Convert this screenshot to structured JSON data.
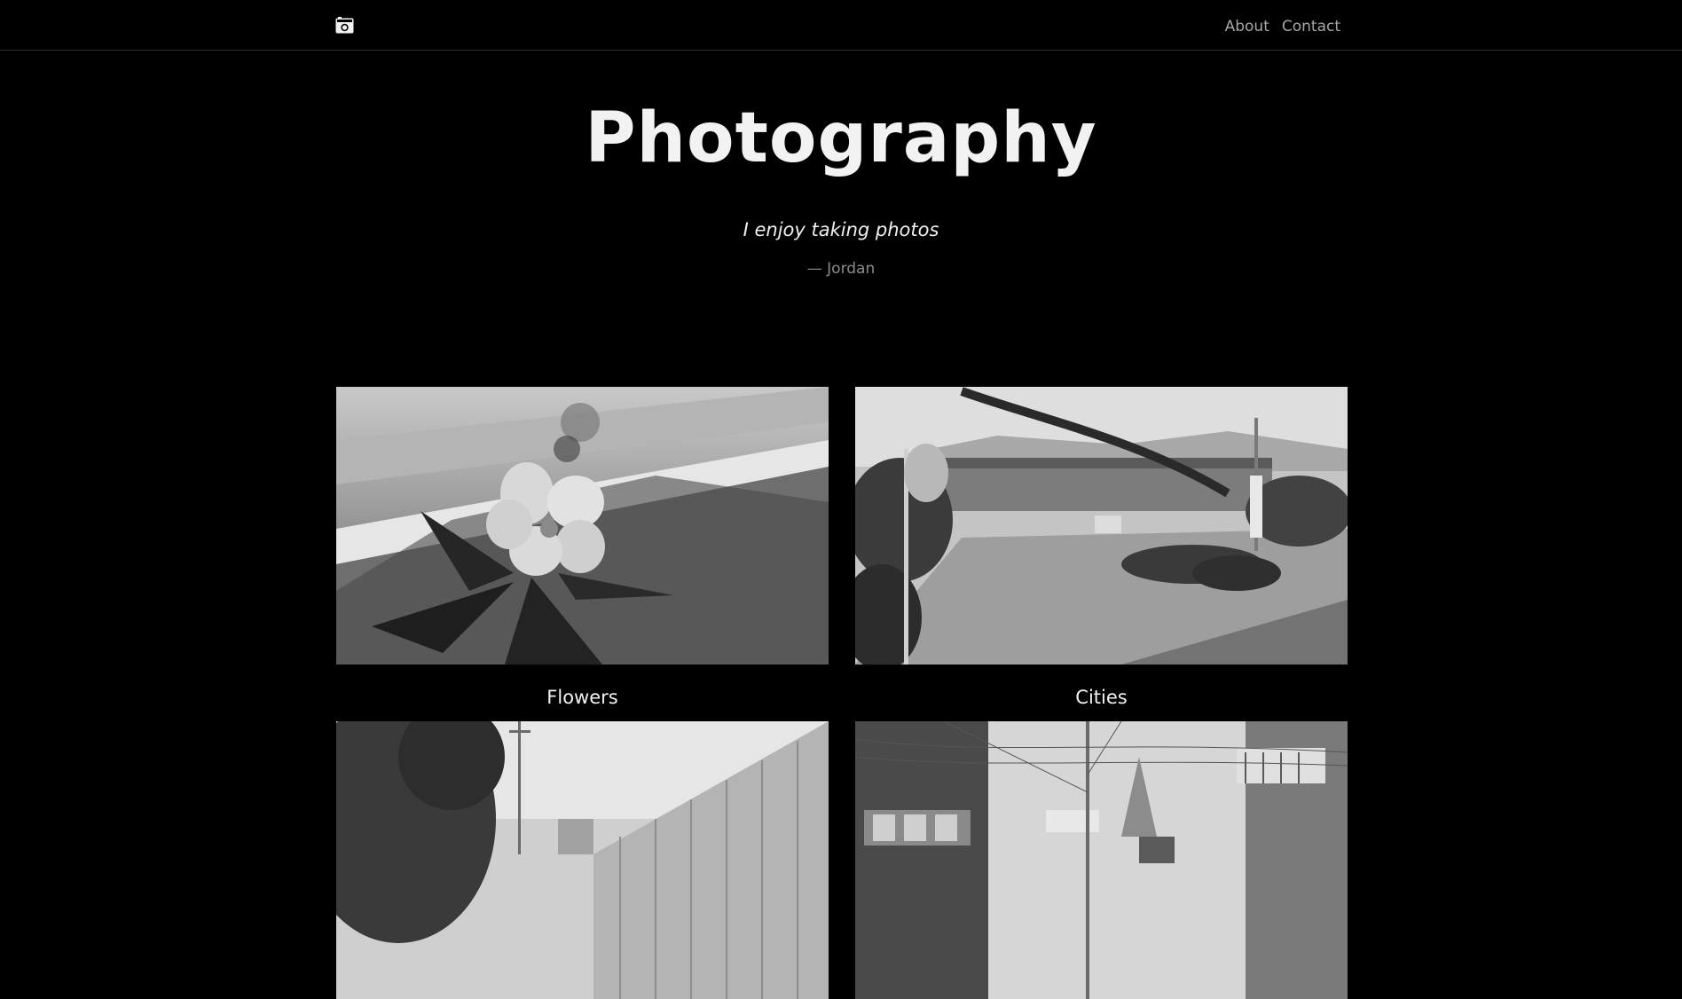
{
  "nav": {
    "logo_icon": "camera-icon",
    "links": [
      {
        "label": "About"
      },
      {
        "label": "Contact"
      }
    ]
  },
  "hero": {
    "title": "Photography",
    "quote": "I enjoy taking photos",
    "author": "— Jordan"
  },
  "gallery": {
    "items": [
      {
        "caption": "Flowers"
      },
      {
        "caption": "Cities"
      },
      {
        "caption": ""
      },
      {
        "caption": ""
      }
    ]
  },
  "colors": {
    "background": "#000000",
    "text": "#f2f2f2",
    "muted": "#a6a6a6",
    "divider": "#2e2e2e"
  }
}
